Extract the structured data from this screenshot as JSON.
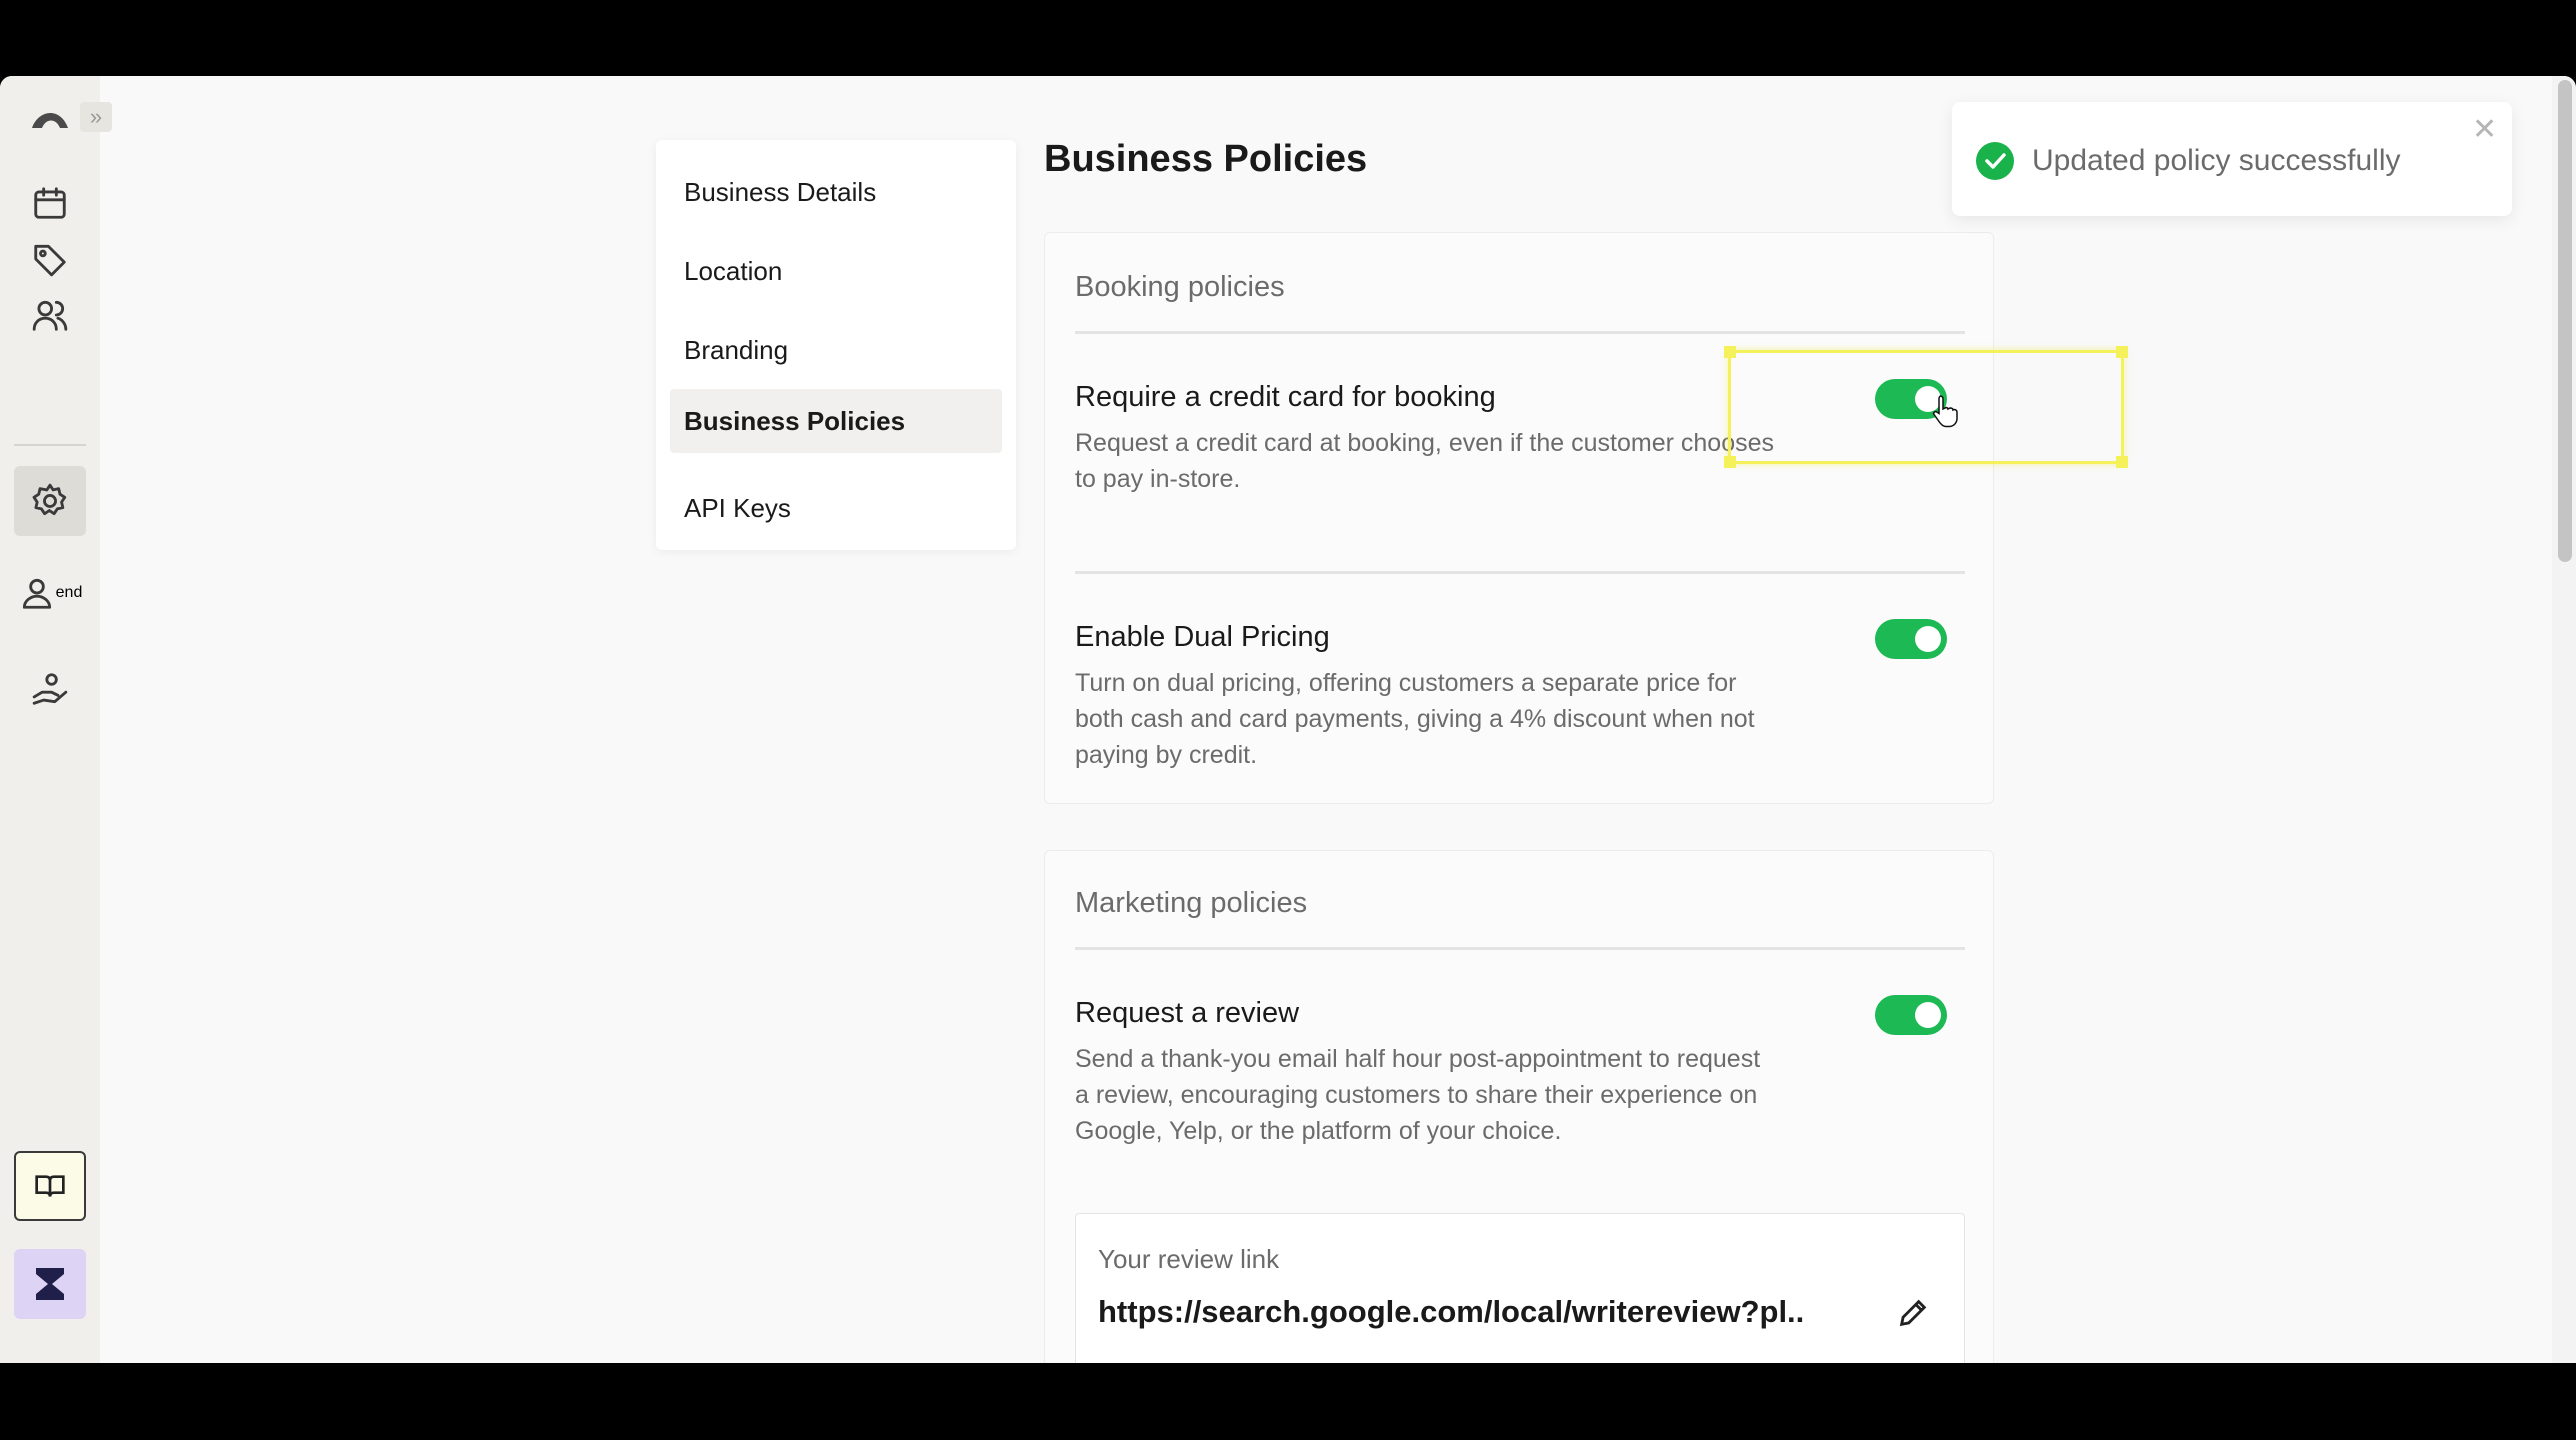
{
  "nav": {
    "items": [
      {
        "label": "Business Details"
      },
      {
        "label": "Location"
      },
      {
        "label": "Branding"
      },
      {
        "label": "Business Policies"
      },
      {
        "label": "API Keys"
      }
    ],
    "active": "Business Policies"
  },
  "page": {
    "title": "Business Policies"
  },
  "booking": {
    "heading": "Booking policies",
    "options": [
      {
        "title": "Require a credit card for booking",
        "desc": "Request a credit card at booking, even if the customer chooses to pay in-store.",
        "enabled": true
      },
      {
        "title": "Enable Dual Pricing",
        "desc": "Turn on dual pricing, offering customers a separate price for both cash and card payments, giving a 4% discount when not paying by credit.",
        "enabled": true
      }
    ]
  },
  "marketing": {
    "heading": "Marketing policies",
    "options": [
      {
        "title": "Request a review",
        "desc": "Send a thank-you email half hour post-appointment to request a review, encouraging customers to share their experience on Google, Yelp, or the platform of your choice.",
        "enabled": true
      }
    ],
    "review_link": {
      "label": "Your review link",
      "value": "https://search.google.com/local/writereview?pl.."
    }
  },
  "toast": {
    "message": "Updated policy successfully"
  },
  "rail": {
    "icons": [
      "logo-icon",
      "calendar-icon",
      "tag-icon",
      "users-icon",
      "gear-icon",
      "person-icon",
      "hand-heart-icon",
      "book-icon",
      "hourglass-icon"
    ]
  },
  "colors": {
    "accent": "#1db954",
    "highlight": "#f4f15a",
    "brand": "#ddd3f5"
  }
}
